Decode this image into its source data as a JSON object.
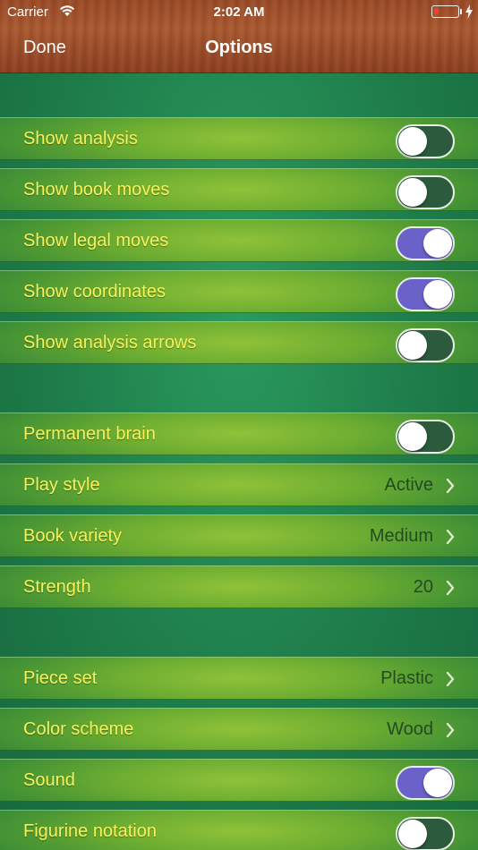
{
  "status_bar": {
    "carrier": "Carrier",
    "time": "2:02 AM",
    "battery_color": "#ff3b30"
  },
  "nav": {
    "done_label": "Done",
    "title": "Options"
  },
  "colors": {
    "label_yellow": "#f8f35a",
    "value_dark": "#244a24",
    "toggle_on": "#6a62c9",
    "toggle_off": "#2b5a3c",
    "wood": "#a8572e"
  },
  "sections": [
    {
      "rows": [
        {
          "label": "Show analysis",
          "type": "toggle",
          "on": false
        },
        {
          "label": "Show book moves",
          "type": "toggle",
          "on": false
        },
        {
          "label": "Show legal moves",
          "type": "toggle",
          "on": true
        },
        {
          "label": "Show coordinates",
          "type": "toggle",
          "on": true
        },
        {
          "label": "Show analysis arrows",
          "type": "toggle",
          "on": false
        }
      ]
    },
    {
      "rows": [
        {
          "label": "Permanent brain",
          "type": "toggle",
          "on": false
        },
        {
          "label": "Play style",
          "type": "disclosure",
          "value": "Active"
        },
        {
          "label": "Book variety",
          "type": "disclosure",
          "value": "Medium"
        },
        {
          "label": "Strength",
          "type": "disclosure",
          "value": "20"
        }
      ]
    },
    {
      "rows": [
        {
          "label": "Piece set",
          "type": "disclosure",
          "value": "Plastic"
        },
        {
          "label": "Color scheme",
          "type": "disclosure",
          "value": "Wood"
        },
        {
          "label": "Sound",
          "type": "toggle",
          "on": true
        },
        {
          "label": "Figurine notation",
          "type": "toggle",
          "on": false
        }
      ]
    }
  ]
}
